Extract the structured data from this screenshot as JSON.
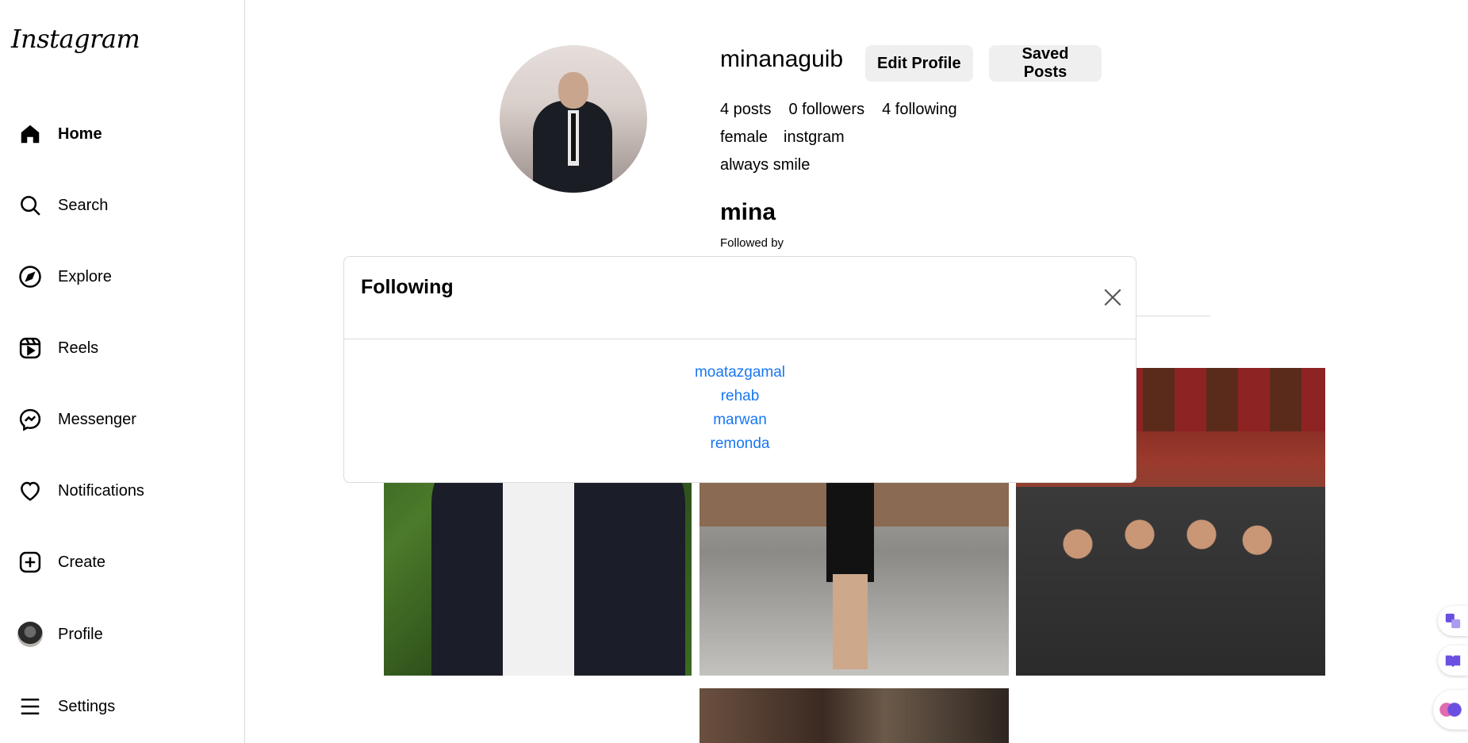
{
  "sidebar": {
    "logo": "Instagram",
    "items": [
      {
        "label": "Home",
        "icon": "home-icon"
      },
      {
        "label": "Search",
        "icon": "search-icon"
      },
      {
        "label": "Explore",
        "icon": "compass-icon"
      },
      {
        "label": "Reels",
        "icon": "reels-icon"
      },
      {
        "label": "Messenger",
        "icon": "messenger-icon"
      },
      {
        "label": "Notifications",
        "icon": "heart-icon"
      },
      {
        "label": "Create",
        "icon": "plus-square-icon"
      },
      {
        "label": "Profile",
        "icon": "avatar"
      },
      {
        "label": "Settings",
        "icon": "menu-icon"
      }
    ]
  },
  "profile": {
    "username": "minanaguib",
    "edit_label": "Edit Profile",
    "saved_label": "Saved Posts",
    "posts": "4 posts",
    "followers": "0 followers",
    "following": "4 following",
    "gender": "female",
    "website": "instgram",
    "bio": "always smile",
    "full_name": "mina",
    "followed_by": "Followed by"
  },
  "modal": {
    "title": "Following",
    "users": [
      "moatazgamal",
      "rehab",
      "marwan",
      "remonda"
    ]
  },
  "colors": {
    "link": "#1877f2",
    "button_bg": "#efefef",
    "border": "#dbdbdb"
  }
}
